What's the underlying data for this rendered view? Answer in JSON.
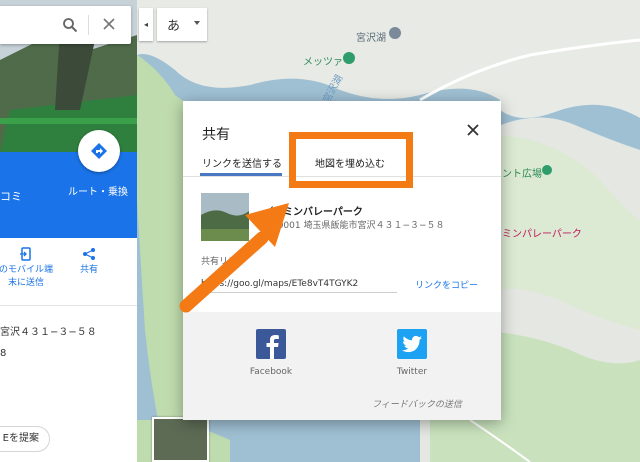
{
  "map": {
    "labels": {
      "lake_name": "宮沢湖",
      "restaurant": "メッツァ",
      "lake_vertical": "宮沢湖",
      "plaza": "ント広場",
      "park": "ミンパレーパーク"
    }
  },
  "search": {
    "clear_glyph": "✕"
  },
  "map_controls": {
    "collapse_glyph": "◂",
    "ime_label": "あ"
  },
  "place_panel": {
    "partial_title": "コミ",
    "route_label": "ルート・乗換",
    "actions": [
      {
        "label": "のモバイル端末に送信"
      },
      {
        "label": "共有"
      }
    ],
    "partial_address": "宮沢４３１−３−５８",
    "partial_small": "8",
    "suggest_label": "Eを提案"
  },
  "share_dialog": {
    "title": "共有",
    "close_glyph": "✕",
    "tabs": [
      {
        "label": "リンクを送信する",
        "active": true
      },
      {
        "label": "地図を埋め込む",
        "active": false
      }
    ],
    "place": {
      "name": "／ーミンバレーパーク",
      "address": "57-0001 埼玉県飯能市宮沢４３１−３−５８"
    },
    "link_label": "共有リンク",
    "link_value": "https://goo.gl/maps/ETe8vT4TGYK2",
    "copy_label": "リンクをコピー",
    "social": [
      {
        "label": "Facebook",
        "color": "#3b5998"
      },
      {
        "label": "Twitter",
        "color": "#1da1f2"
      }
    ],
    "feedback": "フィードバックの送信"
  },
  "annotation": {
    "color": "#f47a16"
  }
}
